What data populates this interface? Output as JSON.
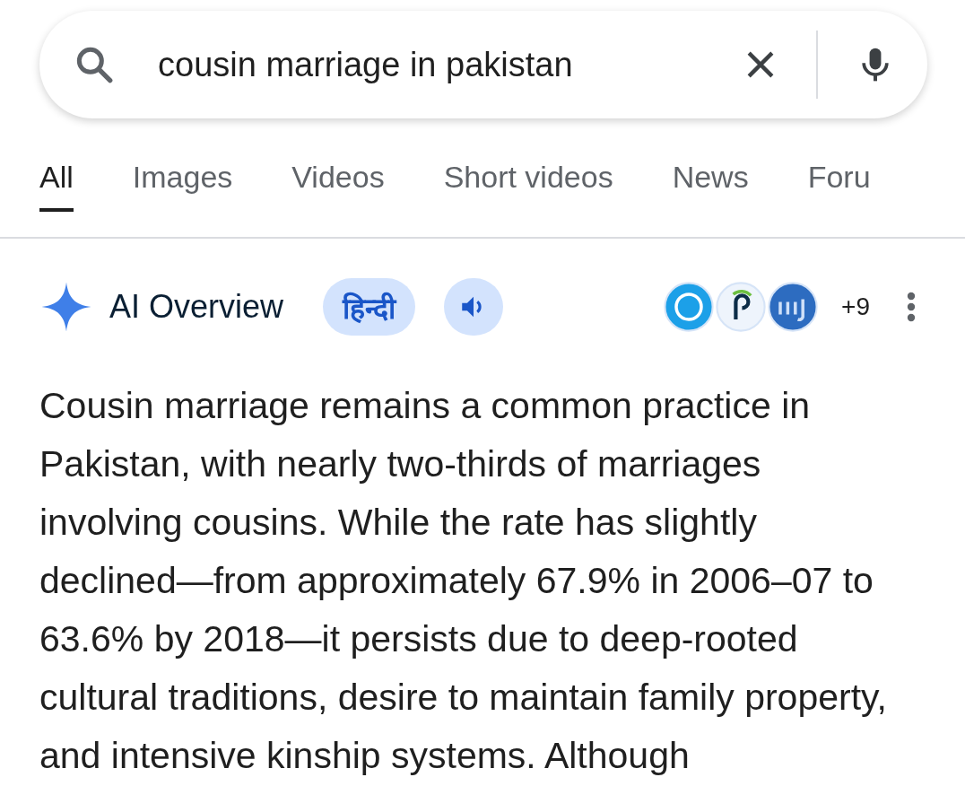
{
  "search": {
    "value": "cousin marriage in pakistan"
  },
  "tabs": [
    {
      "label": "All",
      "selected": true
    },
    {
      "label": "Images",
      "selected": false
    },
    {
      "label": "Videos",
      "selected": false
    },
    {
      "label": "Short videos",
      "selected": false
    },
    {
      "label": "News",
      "selected": false
    },
    {
      "label": "Foru",
      "selected": false
    }
  ],
  "ai_overview": {
    "title": "AI Overview",
    "language_button": "हिन्दी",
    "sources": [
      {
        "color": "#1ca0e8"
      },
      {
        "color": "#eef4fc"
      },
      {
        "color": "#2d6cc0"
      }
    ],
    "more_sources": "+9",
    "text": "Cousin marriage remains a common practice in Pakistan, with nearly two-thirds of marriages involving cousins. While the rate has slightly declined—from approximately 67.9% in 2006–07 to 63.6% by 2018—it persists due to deep-rooted cultural traditions, desire to maintain family property, and intensive kinship systems. Although"
  }
}
